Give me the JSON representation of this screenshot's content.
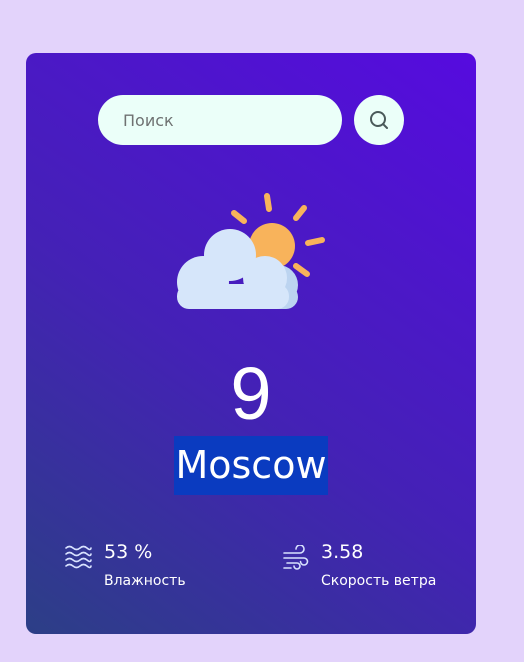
{
  "search": {
    "placeholder": "Поиск",
    "value": "",
    "button_icon": "search-icon"
  },
  "weather": {
    "icon": "partly-cloudy-icon",
    "temperature": "9",
    "city": "Moscow"
  },
  "humidity": {
    "icon": "humidity-waves-icon",
    "value": "53 %",
    "label": "Влажность"
  },
  "wind": {
    "icon": "wind-icon",
    "value": "3.58",
    "label": "Скорость ветра"
  },
  "colors": {
    "page_background": "#e3d3fb",
    "card_gradient_start": "#2c3f86",
    "card_gradient_end": "#560bdf",
    "input_background": "#ebfff9",
    "city_highlight": "#0a3bc0",
    "sun": "#f8b35b",
    "cloud": "#d6e6fa"
  }
}
